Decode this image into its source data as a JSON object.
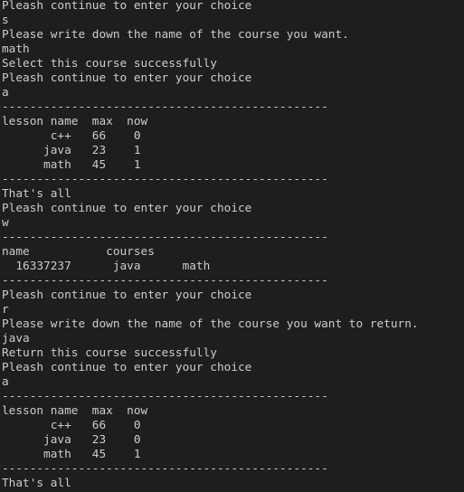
{
  "terminal": {
    "lines": [
      "Pleash continue to enter your choice",
      "s",
      "Please write down the name of the course you want.",
      "math",
      "Select this course successfully",
      "Pleash continue to enter your choice",
      "a",
      "-----------------------------------------------",
      "lesson name  max  now",
      "       c++   66    0",
      "      java   23    1",
      "      math   45    1",
      "-----------------------------------------------",
      "That's all",
      "Pleash continue to enter your choice",
      "w",
      "-----------------------------------------------",
      "name           courses",
      "  16337237      java      math",
      "-----------------------------------------------",
      "Pleash continue to enter your choice",
      "r",
      "Please write down the name of the course you want to return.",
      "java",
      "Return this course successfully",
      "Pleash continue to enter your choice",
      "a",
      "-----------------------------------------------",
      "lesson name  max  now",
      "       c++   66    0",
      "      java   23    0",
      "      math   45    1",
      "-----------------------------------------------",
      "That's all"
    ]
  }
}
